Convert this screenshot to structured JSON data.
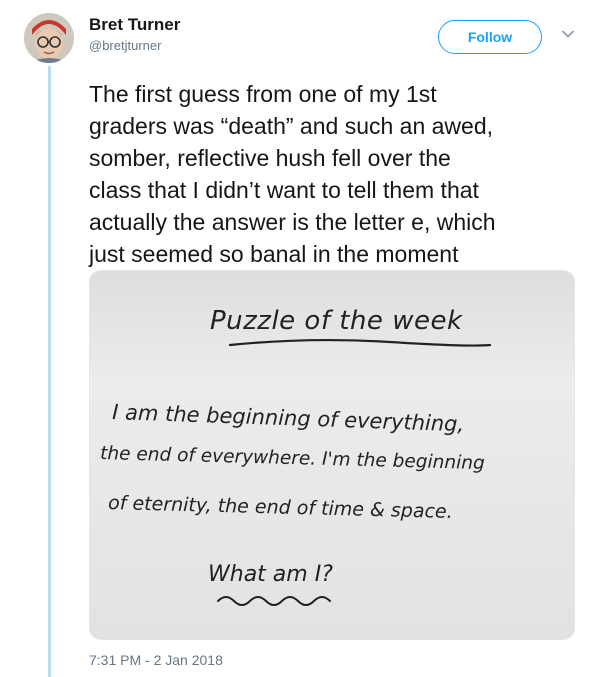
{
  "author": {
    "name": "Bret Turner",
    "handle": "@bretjturner"
  },
  "actions": {
    "follow_label": "Follow"
  },
  "tweet": {
    "text": "The first guess from one of my 1st\ngraders was “death” and such an awed,\nsomber, reflective hush fell over the\nclass that I didn’t want to tell them that\nactually the answer is the letter e, which\njust seemed so banal in the moment",
    "timestamp": "7:31 PM - 2 Jan 2018"
  },
  "photo": {
    "heading": "Puzzle of the week",
    "line1": "I am the beginning of everything,",
    "line2": "the end of everywhere. I'm the beginning",
    "line3": "of eternity, the end of time & space.",
    "question": "What am I?"
  },
  "colors": {
    "accent": "#1da1f2",
    "thread_line": "#b6dcf3",
    "secondary_text": "#657786",
    "marker": "#1f1f1f"
  },
  "icons": {
    "caret": "chevron-down-icon"
  }
}
